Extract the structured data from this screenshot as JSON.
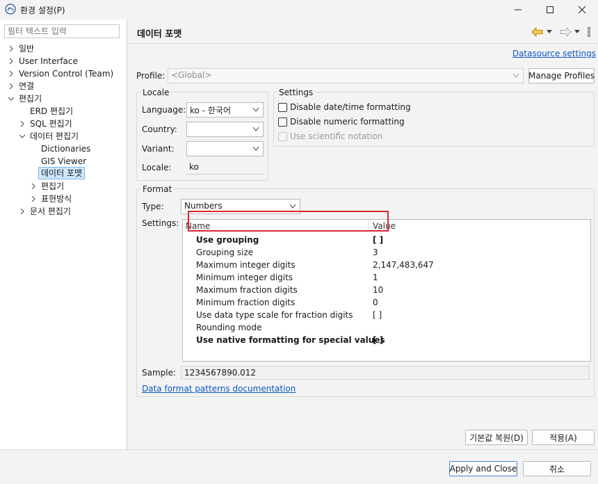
{
  "window": {
    "title": "환경 설정(P)",
    "icon": "gear-app-icon"
  },
  "sidebar": {
    "filter_placeholder": "필터 텍스트 입력",
    "items": [
      {
        "label": "일반",
        "expanded": false
      },
      {
        "label": "User Interface",
        "expanded": false
      },
      {
        "label": "Version Control (Team)",
        "expanded": false
      },
      {
        "label": "연결",
        "expanded": false
      },
      {
        "label": "편집기",
        "expanded": true
      },
      {
        "label": "ERD 편집기"
      },
      {
        "label": "SQL 편집기",
        "expanded": false
      },
      {
        "label": "데이터 편집기",
        "expanded": true
      },
      {
        "label": "Dictionaries"
      },
      {
        "label": "GIS Viewer"
      },
      {
        "label": "데이터 포맷",
        "selected": true
      },
      {
        "label": "편집기",
        "expanded": false
      },
      {
        "label": "표현방식",
        "expanded": false
      },
      {
        "label": "문서 편집기",
        "expanded": false
      }
    ]
  },
  "page": {
    "title": "데이터 포맷",
    "datasource_link": "Datasource settings",
    "profile": {
      "label": "Profile:",
      "value": "<Global>",
      "manage_button": "Manage Profiles"
    }
  },
  "locale": {
    "title": "Locale",
    "language_label": "Language:",
    "language_value": "ko - 한국어",
    "country_label": "Country:",
    "country_value": "",
    "variant_label": "Variant:",
    "variant_value": "",
    "locale_label": "Locale:",
    "locale_value": "ko"
  },
  "settings": {
    "title": "Settings",
    "disable_datetime": "Disable date/time formatting",
    "disable_numeric": "Disable numeric formatting",
    "scientific": "Use scientific notation"
  },
  "format": {
    "title": "Format",
    "type_label": "Type:",
    "type_value": "Numbers",
    "settings_label": "Settings:",
    "columns": {
      "name": "Name",
      "value": "Value"
    },
    "rows": [
      {
        "name": "Use grouping",
        "value": "[ ]",
        "bold": true
      },
      {
        "name": "Grouping size",
        "value": "3",
        "bold": false
      },
      {
        "name": "Maximum integer digits",
        "value": "2,147,483,647",
        "bold": false
      },
      {
        "name": "Minimum integer digits",
        "value": "1",
        "bold": false
      },
      {
        "name": "Maximum fraction digits",
        "value": "10",
        "bold": false
      },
      {
        "name": "Minimum fraction digits",
        "value": "0",
        "bold": false
      },
      {
        "name": "Use data type scale for fraction digits",
        "value": "[ ]",
        "bold": false
      },
      {
        "name": "Rounding mode",
        "value": "",
        "bold": false
      },
      {
        "name": "Use native formatting for special values",
        "value": "[ ]",
        "bold": true
      }
    ],
    "sample_label": "Sample:",
    "sample_value": "1234567890.012",
    "docs_link": "Data format patterns documentation"
  },
  "buttons": {
    "restore_defaults": "기본값 복원(D)",
    "apply": "적용(A)",
    "apply_close": "Apply and Close",
    "cancel": "취소"
  },
  "colors": {
    "accent": "#0b57c6",
    "selection": "#cde8ff",
    "highlight": "#d9272e"
  }
}
